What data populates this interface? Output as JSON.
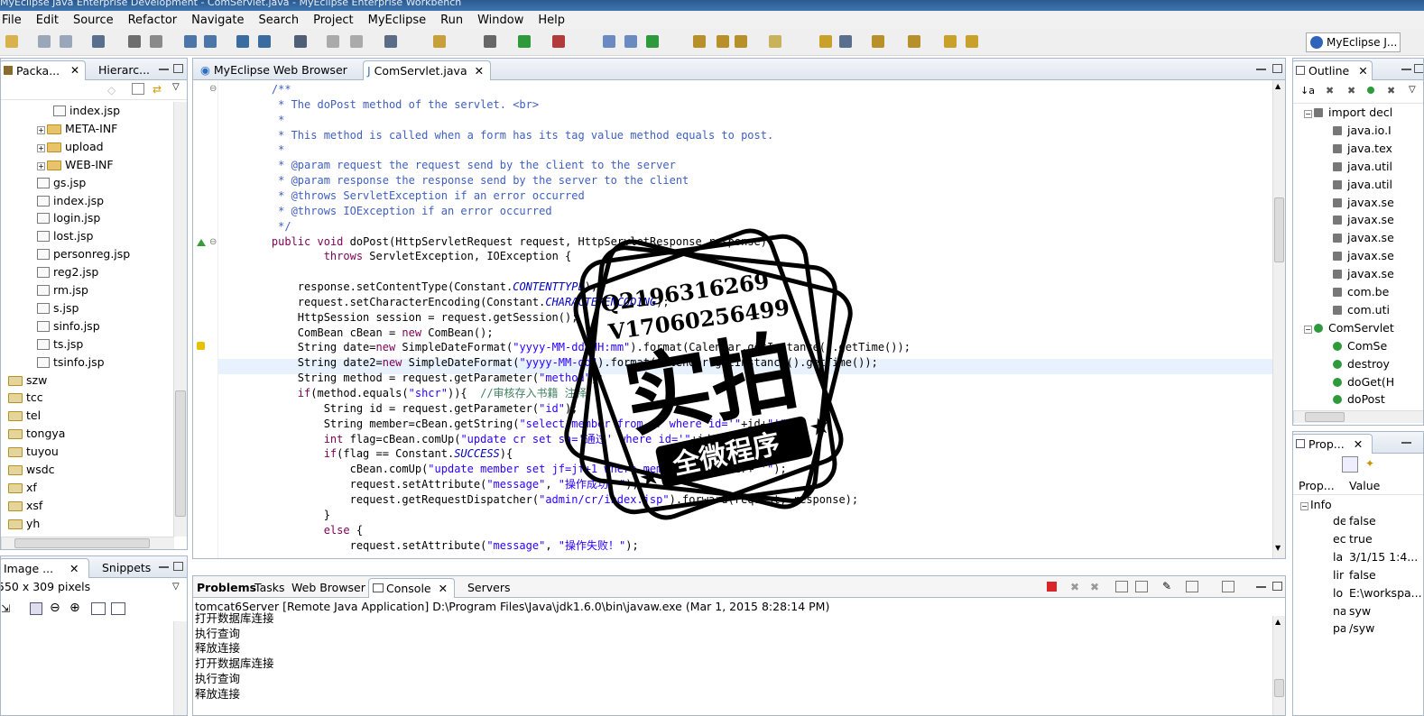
{
  "window": {
    "title": "MyEclipse Java Enterprise Development - ComServlet.java - MyEclipse Enterprise Workbench"
  },
  "menu": [
    "File",
    "Edit",
    "Source",
    "Refactor",
    "Navigate",
    "Search",
    "Project",
    "MyEclipse",
    "Run",
    "Window",
    "Help"
  ],
  "perspective": {
    "label": "MyEclipse J..."
  },
  "left_panel": {
    "tabs": [
      "Packa...",
      "Hierarc..."
    ],
    "tree": [
      {
        "label": "index.jsp",
        "type": "file",
        "indent": 3
      },
      {
        "label": "META-INF",
        "type": "folder",
        "indent": 2
      },
      {
        "label": "upload",
        "type": "folder",
        "indent": 2
      },
      {
        "label": "WEB-INF",
        "type": "folder",
        "indent": 2
      },
      {
        "label": "gs.jsp",
        "type": "file",
        "indent": 2
      },
      {
        "label": "index.jsp",
        "type": "file",
        "indent": 2
      },
      {
        "label": "login.jsp",
        "type": "file",
        "indent": 2
      },
      {
        "label": "lost.jsp",
        "type": "file",
        "indent": 2
      },
      {
        "label": "personreg.jsp",
        "type": "file",
        "indent": 2
      },
      {
        "label": "reg2.jsp",
        "type": "file",
        "indent": 2
      },
      {
        "label": "rm.jsp",
        "type": "file",
        "indent": 2
      },
      {
        "label": "s.jsp",
        "type": "file",
        "indent": 2
      },
      {
        "label": "sinfo.jsp",
        "type": "file",
        "indent": 2
      },
      {
        "label": "ts.jsp",
        "type": "file",
        "indent": 2
      },
      {
        "label": "tsinfo.jsp",
        "type": "file",
        "indent": 2
      },
      {
        "label": "szw",
        "type": "project",
        "indent": 1
      },
      {
        "label": "tcc",
        "type": "project",
        "indent": 1
      },
      {
        "label": "tel",
        "type": "project",
        "indent": 1
      },
      {
        "label": "tongya",
        "type": "project",
        "indent": 1
      },
      {
        "label": "tuyou",
        "type": "project",
        "indent": 1
      },
      {
        "label": "wsdc",
        "type": "project",
        "indent": 1
      },
      {
        "label": "xf",
        "type": "project",
        "indent": 1
      },
      {
        "label": "xsf",
        "type": "project",
        "indent": 1
      },
      {
        "label": "yh",
        "type": "project",
        "indent": 1
      }
    ]
  },
  "image_panel": {
    "tabs": [
      "Image ...",
      "Snippets"
    ],
    "size_text": "550 x 309 pixels"
  },
  "editor": {
    "tabs": [
      "MyEclipse Web Browser",
      "ComServlet.java"
    ],
    "lines": [
      "    /**",
      "     * The doPost method of the servlet. <br>",
      "     *",
      "     * This method is called when a form has its tag value method equals to post.",
      "     *",
      "     * @param request the request send by the client to the server",
      "     * @param response the response send by the server to the client",
      "     * @throws ServletException if an error occurred",
      "     * @throws IOException if an error occurred",
      "     */",
      "    public void doPost(HttpServletRequest request, HttpServletResponse response)",
      "            throws ServletException, IOException {",
      "",
      "        response.setContentType(Constant.CONTENTTYPE);",
      "        request.setCharacterEncoding(Constant.CHARACTERENCODING);",
      "        HttpSession session = request.getSession();",
      "        ComBean cBean = new ComBean();",
      "        String date=new SimpleDateFormat(\"yyyy-MM-dd HH:mm\").format(Calendar.getInstance().getTime());",
      "        String date2=new SimpleDateFormat(\"yyyy-MM-dd\").format(Calendar.getInstance().getTime());",
      "        String method = request.getParameter(\"method\");",
      "        if(method.equals(\"shcr\")){  //审核存入书籍 注释",
      "            String id = request.getParameter(\"id\");",
      "            String member=cBean.getString(\"select member from cr where id='\"+id+\"'\");",
      "            int flag=cBean.comUp(\"update cr set sh='通过' where id='\"+id+\"'\");",
      "            if(flag == Constant.SUCCESS){",
      "                cBean.comUp(\"update member set jf=jf+1 where member='\"+member+\"'\");",
      "                request.setAttribute(\"message\", \"操作成功！\");",
      "                request.getRequestDispatcher(\"admin/cr/index.jsp\").forward(request, response);",
      "            }",
      "            else {",
      "                request.setAttribute(\"message\", \"操作失败！\");"
    ]
  },
  "outline": {
    "tab": "Outline",
    "items": [
      {
        "label": "import decl",
        "indent": 1
      },
      {
        "label": "java.io.I",
        "indent": 2
      },
      {
        "label": "java.tex",
        "indent": 2
      },
      {
        "label": "java.util",
        "indent": 2
      },
      {
        "label": "java.util",
        "indent": 2
      },
      {
        "label": "javax.se",
        "indent": 2
      },
      {
        "label": "javax.se",
        "indent": 2
      },
      {
        "label": "javax.se",
        "indent": 2
      },
      {
        "label": "javax.se",
        "indent": 2
      },
      {
        "label": "javax.se",
        "indent": 2
      },
      {
        "label": "com.be",
        "indent": 2
      },
      {
        "label": "com.uti",
        "indent": 2
      },
      {
        "label": "ComServlet",
        "indent": 1
      },
      {
        "label": "ComSe",
        "indent": 2
      },
      {
        "label": "destroy",
        "indent": 2
      },
      {
        "label": "doGet(H",
        "indent": 2
      },
      {
        "label": "doPost",
        "indent": 2
      }
    ]
  },
  "properties": {
    "tab": "Prop...",
    "col_property": "Prop...",
    "col_value": "Value",
    "group": "Info",
    "rows": [
      {
        "k": "de",
        "v": "false"
      },
      {
        "k": "ec",
        "v": "true"
      },
      {
        "k": "la",
        "v": "3/1/15 1:4..."
      },
      {
        "k": "lir",
        "v": "false"
      },
      {
        "k": "lo",
        "v": "E:\\workspa..."
      },
      {
        "k": "na",
        "v": "syw"
      },
      {
        "k": "pa",
        "v": "/syw"
      }
    ]
  },
  "console": {
    "tabs": [
      "Problems",
      "Tasks",
      "Web Browser",
      "Console",
      "Servers"
    ],
    "header": "tomcat6Server [Remote Java Application] D:\\Program Files\\Java\\jdk1.6.0\\bin\\javaw.exe (Mar 1, 2015 8:28:14 PM)",
    "lines": [
      "打开数据库连接",
      "执行查询",
      "释放连接",
      "打开数据库连接",
      "执行查询",
      "释放连接"
    ]
  },
  "watermark": {
    "line1": "Q2196316269",
    "line2": "V17060256499",
    "big": "实拍",
    "small": "全微程序"
  }
}
